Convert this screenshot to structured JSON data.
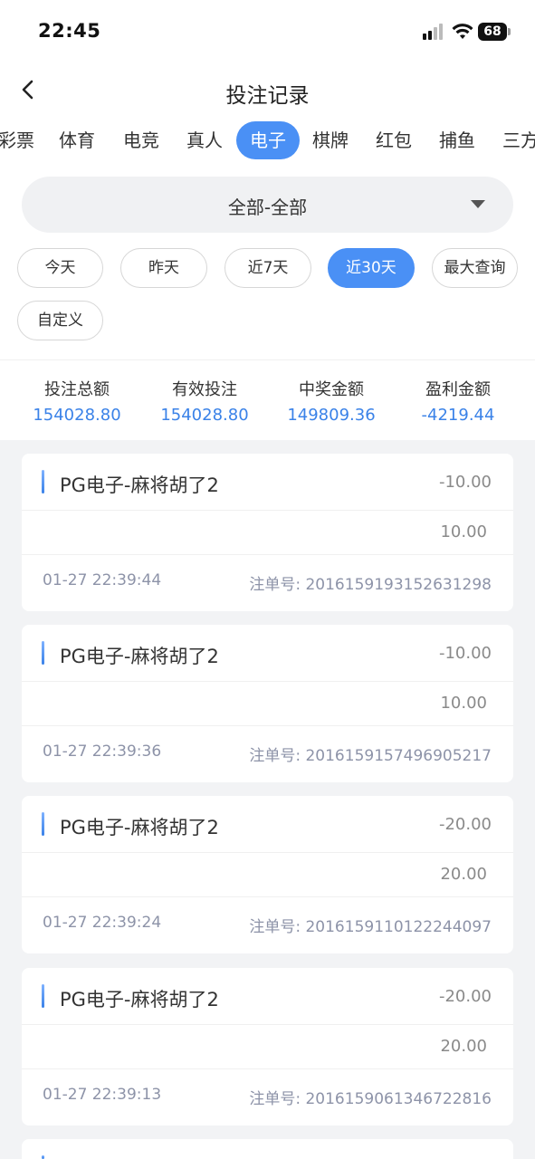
{
  "status": {
    "time": "22:45",
    "battery": "68"
  },
  "nav": {
    "title": "投注记录"
  },
  "tabs": [
    {
      "label": "彩票"
    },
    {
      "label": "体育"
    },
    {
      "label": "电竞"
    },
    {
      "label": "真人"
    },
    {
      "label": "电子",
      "active": true
    },
    {
      "label": "棋牌"
    },
    {
      "label": "红包"
    },
    {
      "label": "捕鱼"
    },
    {
      "label": "三方"
    }
  ],
  "filter": {
    "selected": "全部-全部"
  },
  "dates": [
    {
      "label": "今天"
    },
    {
      "label": "昨天"
    },
    {
      "label": "近7天"
    },
    {
      "label": "近30天",
      "active": true
    },
    {
      "label": "最大查询"
    },
    {
      "label": "自定义"
    }
  ],
  "stats": [
    {
      "label": "投注总额",
      "value": "154028.80"
    },
    {
      "label": "有效投注",
      "value": "154028.80"
    },
    {
      "label": "中奖金额",
      "value": "149809.36"
    },
    {
      "label": "盈利金额",
      "value": "-4219.44"
    }
  ],
  "records": [
    {
      "title": "PG电子-麻将胡了2",
      "amount": "-10.00",
      "valid": "10.00",
      "time": "01-27 22:39:44",
      "order_label": "注单号:",
      "order": "2016159193152631298"
    },
    {
      "title": "PG电子-麻将胡了2",
      "amount": "-10.00",
      "valid": "10.00",
      "time": "01-27 22:39:36",
      "order_label": "注单号:",
      "order": "2016159157496905217"
    },
    {
      "title": "PG电子-麻将胡了2",
      "amount": "-20.00",
      "valid": "20.00",
      "time": "01-27 22:39:24",
      "order_label": "注单号:",
      "order": "2016159110122244097"
    },
    {
      "title": "PG电子-麻将胡了2",
      "amount": "-20.00",
      "valid": "20.00",
      "time": "01-27 22:39:13",
      "order_label": "注单号:",
      "order": "2016159061346722816"
    }
  ],
  "colors": {
    "accent": "#4a90f5",
    "stat_value": "#3a82e8",
    "muted": "#8d93a8"
  },
  "icons": {
    "back": "chevron-left-icon",
    "dropdown": "caret-down-icon",
    "wifi": "wifi-icon",
    "signal": "signal-icon",
    "battery": "battery-icon"
  }
}
